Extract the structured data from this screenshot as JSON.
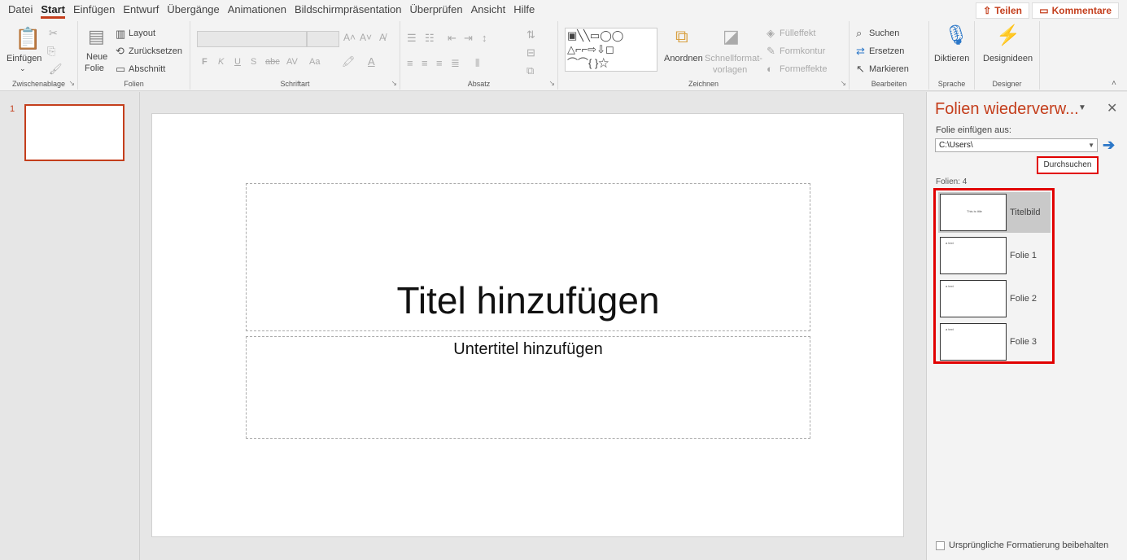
{
  "menu": {
    "items": [
      "Datei",
      "Start",
      "Einfügen",
      "Entwurf",
      "Übergänge",
      "Animationen",
      "Bildschirmpräsentation",
      "Überprüfen",
      "Ansicht",
      "Hilfe"
    ],
    "active_index": 1,
    "share_label": "Teilen",
    "comments_label": "Kommentare"
  },
  "ribbon": {
    "clipboard": {
      "paste_label": "Einfügen",
      "group_label": "Zwischenablage"
    },
    "slides": {
      "new_slide_line1": "Neue",
      "new_slide_line2": "Folie",
      "layout_label": "Layout",
      "reset_label": "Zurücksetzen",
      "section_label": "Abschnitt",
      "group_label": "Folien"
    },
    "font": {
      "bold": "F",
      "italic": "K",
      "underline": "U",
      "shadow": "S",
      "strike": "abc",
      "spacing": "AV",
      "case": "Aa",
      "group_label": "Schriftart"
    },
    "paragraph": {
      "group_label": "Absatz"
    },
    "drawing": {
      "arrange_label": "Anordnen",
      "quickstyles_line1": "Schnellformat-",
      "quickstyles_line2": "vorlagen",
      "fill_label": "Fülleffekt",
      "outline_label": "Formkontur",
      "effects_label": "Formeffekte",
      "group_label": "Zeichnen"
    },
    "editing": {
      "find_label": "Suchen",
      "replace_label": "Ersetzen",
      "select_label": "Markieren",
      "group_label": "Bearbeiten"
    },
    "voice": {
      "dictate_label": "Diktieren",
      "group_label": "Sprache"
    },
    "designer": {
      "ideas_label": "Designideen",
      "group_label": "Designer"
    }
  },
  "thumbnails": {
    "number": "1"
  },
  "slide": {
    "title_placeholder": "Titel hinzufügen",
    "subtitle_placeholder": "Untertitel hinzufügen"
  },
  "reuse_pane": {
    "title": "Folien wiederverw...",
    "insert_from_label": "Folie einfügen aus:",
    "path_value": "C:\\Users\\",
    "browse_label": "Durchsuchen",
    "count_label": "Folien: 4",
    "slides": [
      {
        "name": "Titelbild",
        "selected": true,
        "thumb_text": "This is title"
      },
      {
        "name": "Folie 1",
        "selected": false,
        "thumb_text": "a text"
      },
      {
        "name": "Folie 2",
        "selected": false,
        "thumb_text": "a text"
      },
      {
        "name": "Folie 3",
        "selected": false,
        "thumb_text": "a text"
      }
    ],
    "keep_formatting_label": "Ursprüngliche Formatierung beibehalten",
    "keep_formatting_checked": false
  },
  "colors": {
    "accent": "#c43e1c",
    "highlight_red": "#e10000",
    "arrow_blue": "#2b77c8"
  }
}
